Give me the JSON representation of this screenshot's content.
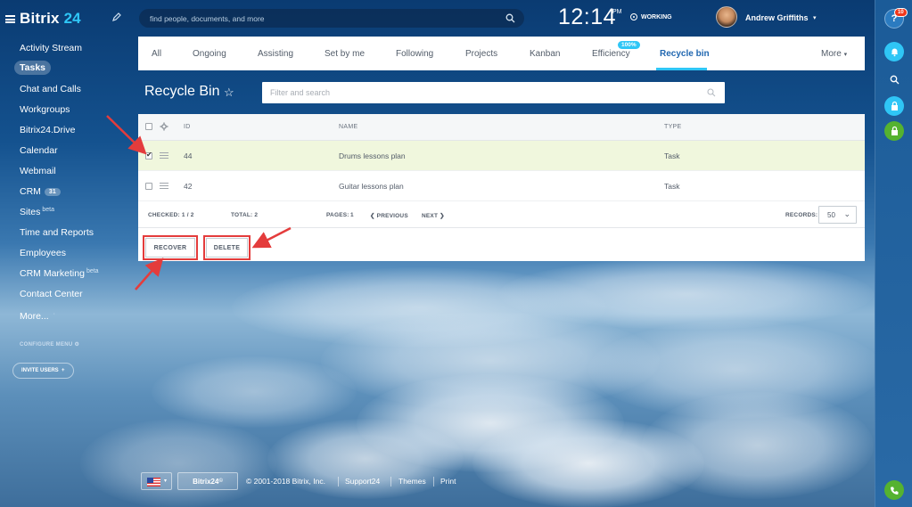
{
  "brand": {
    "name": "Bitrix",
    "version": "24"
  },
  "nav": {
    "items": [
      {
        "label": "Activity Stream"
      },
      {
        "label": "Tasks",
        "active": true
      },
      {
        "label": "Chat and Calls"
      },
      {
        "label": "Workgroups"
      },
      {
        "label": "Bitrix24.Drive"
      },
      {
        "label": "Calendar"
      },
      {
        "label": "Webmail"
      },
      {
        "label": "CRM",
        "counter": "31"
      },
      {
        "label": "Sites",
        "sup": "beta"
      },
      {
        "label": "Time and Reports"
      },
      {
        "label": "Employees"
      },
      {
        "label": "CRM Marketing",
        "sup": "beta"
      },
      {
        "label": "Contact Center"
      },
      {
        "label": "More...",
        "caret": "·"
      }
    ],
    "configure_menu": "CONFIGURE MENU",
    "invite_users": "INVITE USERS"
  },
  "header": {
    "search_placeholder": "find people, documents, and more",
    "clock": "12:14",
    "meridiem": "PM",
    "working_status": "WORKING",
    "user_name": "Andrew Griffiths"
  },
  "tabs": {
    "items": [
      "All",
      "Ongoing",
      "Assisting",
      "Set by me",
      "Following",
      "Projects",
      "Kanban",
      "Efficiency",
      "Recycle bin",
      "More"
    ],
    "active": "Recycle bin",
    "efficiency_badge": "100%"
  },
  "page": {
    "title": "Recycle Bin",
    "star": "☆",
    "filter_placeholder": "Filter and search"
  },
  "grid": {
    "columns": [
      "ID",
      "NAME",
      "TYPE"
    ],
    "rows": [
      {
        "id": "44",
        "name": "Drums lessons plan",
        "type": "Task",
        "checked": true
      },
      {
        "id": "42",
        "name": "Guitar lessons plan",
        "type": "Task",
        "checked": false
      }
    ],
    "footer": {
      "checked": "CHECKED: 1 / 2",
      "total": "TOTAL: 2",
      "pages": "PAGES:",
      "page_num": "1",
      "previous": "PREVIOUS",
      "next": "NEXT",
      "records_label": "RECORDS:",
      "records_value": "50"
    }
  },
  "actions": {
    "recover": "RECOVER",
    "delete": "DELETE"
  },
  "right_panel": {
    "notifications_count": "10"
  },
  "bottom": {
    "brand": "Bitrix24",
    "brand_mark": "©",
    "copyright": "© 2001-2018 Bitrix, Inc.",
    "support": "Support24",
    "themes": "Themes",
    "print": "Print"
  },
  "colors": {
    "accent": "#2067b0",
    "tab_underline": "#2fc6f6",
    "selected_row": "#f0f7dd",
    "annotation_red": "#e43c3c",
    "badge_red": "#f0371b",
    "phone_green": "#55b230"
  }
}
